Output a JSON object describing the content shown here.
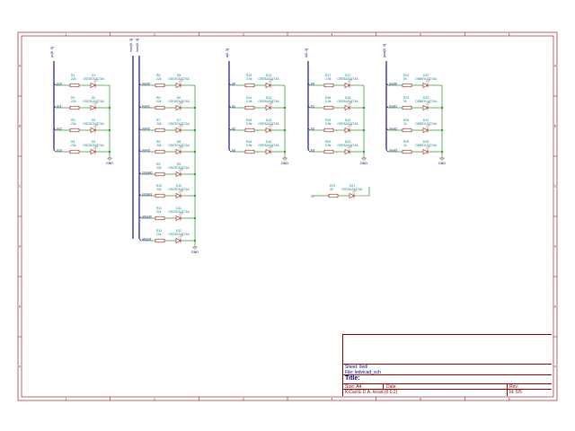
{
  "border": {
    "columns": [
      "1",
      "2",
      "3",
      "4",
      "5",
      "6"
    ],
    "rows": [
      "A",
      "B",
      "C",
      "D",
      "E",
      "F"
    ]
  },
  "colors": {
    "frame": "#8b0000",
    "wire": "#008000",
    "part": "#8b0000",
    "label": "#000080",
    "ref": "#008080",
    "bus": "#000080"
  },
  "groups": [
    {
      "bus": "pc[0..3]",
      "rows": [
        {
          "net": "pc0",
          "r": "R1",
          "rv": "22k",
          "d": "D1",
          "dv": "OSG57A3Z74A"
        },
        {
          "net": "pc1",
          "r": "R2",
          "rv": "22k",
          "d": "D2",
          "dv": "OSG57A3Z74A"
        },
        {
          "net": "pc2",
          "r": "R3",
          "rv": "22k",
          "d": "D3",
          "dv": "OSG57A3Z74A"
        },
        {
          "net": "pc3",
          "r": "R4",
          "rv": "22k",
          "d": "D4",
          "dv": "OSG57A3Z74A"
        }
      ],
      "gnd": "GND"
    },
    {
      "bus": "irom[0..3]",
      "bus2": "irom[0..3]",
      "rows": [
        {
          "net": "irom0",
          "r": "R5",
          "rv": "22k",
          "d": "D5",
          "dv": "OSG57A3Z74A"
        },
        {
          "net": "irom1",
          "r": "R6",
          "rv": "22k",
          "d": "D6",
          "dv": "OSG57A3Z74A"
        },
        {
          "net": "irom2",
          "r": "R7",
          "rv": "22k",
          "d": "D7",
          "dv": "OSG57A3Z74A"
        },
        {
          "net": "irom3",
          "r": "R8",
          "rv": "22k",
          "d": "D8",
          "dv": "OSG57A3Z74A"
        },
        {
          "net": "srcsel0",
          "r": "R9",
          "rv": "22k",
          "d": "D9",
          "dv": "OSG57A3Z74A"
        },
        {
          "net": "srcsel1",
          "r": "R10",
          "rv": "22k",
          "d": "D10",
          "dv": "OSG57A3Z74A"
        },
        {
          "net": "absel0",
          "r": "R11",
          "rv": "22k",
          "d": "D11",
          "dv": "OSG57A3Z74A"
        },
        {
          "net": "absel1",
          "r": "R12",
          "rv": "22k",
          "d": "D12",
          "dv": "OSG57A3Z74A"
        }
      ],
      "gnd": "GND"
    },
    {
      "bus": "a[0..3]",
      "rows": [
        {
          "net": "a0",
          "r": "R13",
          "rv": "3.9k",
          "d": "D13",
          "dv": "OSR5JA3Z74A"
        },
        {
          "net": "a1",
          "r": "R14",
          "rv": "3.9k",
          "d": "D14",
          "dv": "OSR5JA3Z74A"
        },
        {
          "net": "a2",
          "r": "R15",
          "rv": "3.9k",
          "d": "D15",
          "dv": "OSR5JA3Z74A"
        },
        {
          "net": "a3",
          "r": "R16",
          "rv": "3.9k",
          "d": "D16",
          "dv": "OSR5JA3Z74A"
        }
      ],
      "gnd": "GND"
    },
    {
      "bus": "b[0..3]",
      "rows": [
        {
          "net": "b0",
          "r": "R17",
          "rv": "3.9k",
          "d": "D17",
          "dv": "OSR5JA3Z74A"
        },
        {
          "net": "b1",
          "r": "R18",
          "rv": "3.9k",
          "d": "D18",
          "dv": "OSR5JA3Z74A"
        },
        {
          "net": "b2",
          "r": "R19",
          "rv": "3.9k",
          "d": "D19",
          "dv": "OSR5JA3Z74A"
        },
        {
          "net": "b3",
          "r": "R20",
          "rv": "3.9k",
          "d": "D20",
          "dv": "OSR5JA3Z74A"
        }
      ],
      "gnd": "GND"
    },
    {
      "bus": "pout[0..3]",
      "rows": [
        {
          "net": "pout0",
          "r": "R22",
          "rv": "2k",
          "d": "D22",
          "dv": "OSB5YU3Z74A"
        },
        {
          "net": "pout1",
          "r": "R23",
          "rv": "2k",
          "d": "D23",
          "dv": "OSB5YU3Z74A"
        },
        {
          "net": "pout2",
          "r": "R24",
          "rv": "2k",
          "d": "D24",
          "dv": "OSB5YU3Z74A"
        },
        {
          "net": "pout3",
          "r": "R25",
          "rv": "2k",
          "d": "D25",
          "dv": "OSB5YU3Z74A"
        }
      ],
      "gnd": "GND"
    }
  ],
  "single": {
    "net": "c0",
    "r": "R21",
    "rv": "2k",
    "d": "D21",
    "dv": "OSY5JA3Z74A"
  },
  "title_block": {
    "sheet": "Sheet: /led/",
    "file": "File: ledvicad_sch",
    "title_label": "Title:",
    "size": "Size: A4",
    "date": "Date:",
    "rev": "Rev:",
    "tool": "KiCad E.D.A.  kicad (6.0.2)",
    "id": "Id: 5/5"
  }
}
